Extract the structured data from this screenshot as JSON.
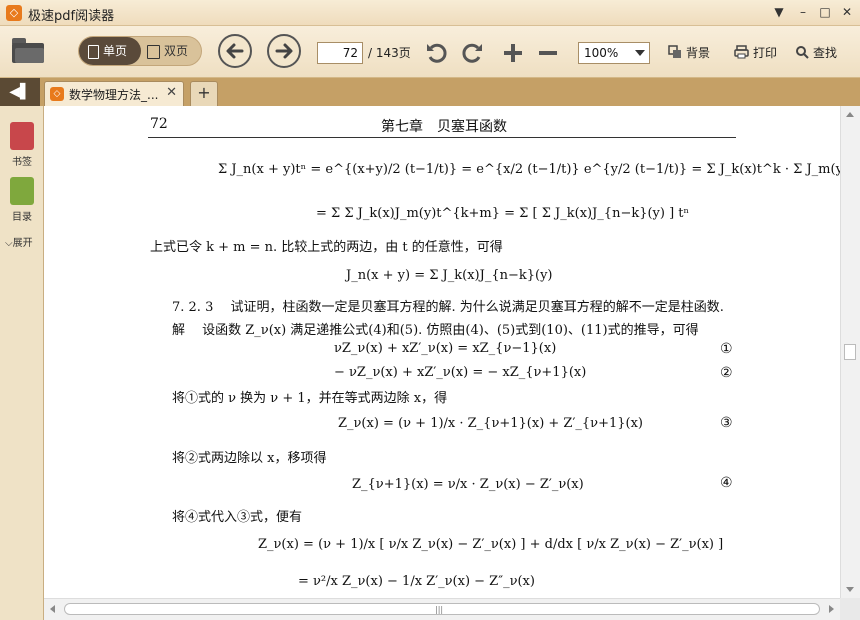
{
  "app": {
    "title": "极速pdf阅读器",
    "logo": "app-logo"
  },
  "window": {
    "menu": "▼",
    "minimize": "–",
    "maximize": "□",
    "close": "✕"
  },
  "toolbar": {
    "open_icon": "folder-icon",
    "view_single": "单页",
    "view_double": "双页",
    "page_current": "72",
    "page_total": "/ 143页",
    "zoom": "100%",
    "background": "背景",
    "print": "打印",
    "search": "查找"
  },
  "tabs": {
    "back_icon": "back-icon",
    "doc_title": "数学物理方法_...",
    "close": "✕",
    "new": "+"
  },
  "sidebar": {
    "bookmark": "书签",
    "toc": "目录",
    "expand": "展开"
  },
  "page": {
    "number": "72",
    "chapter": "第七章　贝塞耳函数",
    "lines": [
      "Σ J_n(x + y)tⁿ = e^{(x+y)/2 (t−1/t)} = e^{x/2 (t−1/t)} e^{y/2 (t−1/t)} = Σ J_k(x)t^k · Σ J_m(y)t^m",
      "= Σ Σ J_k(x)J_m(y)t^{k+m} = Σ [ Σ J_k(x)J_{n−k}(y) ] tⁿ",
      "上式已令 k + m = n. 比较上式的两边，由 t 的任意性，可得",
      "J_n(x + y) = Σ J_k(x)J_{n−k}(y)",
      "7. 2. 3　 试证明，柱函数一定是贝塞耳方程的解. 为什么说满足贝塞耳方程的解不一定是柱函数.",
      "解　 设函数 Z_ν(x) 满足递推公式(4)和(5). 仿照由(4)、(5)式到(10)、(11)式的推导，可得",
      "νZ_ν(x) + xZ′_ν(x) = xZ_{ν−1}(x)",
      "− νZ_ν(x) + xZ′_ν(x) = − xZ_{ν+1}(x)",
      "将①式的 ν 换为 ν + 1，并在等式两边除 x，得",
      "Z_ν(x) = (ν + 1)/x · Z_{ν+1}(x) + Z′_{ν+1}(x)",
      "将②式两边除以 x，移项得",
      "Z_{ν+1}(x) = ν/x · Z_ν(x) − Z′_ν(x)",
      "将④式代入③式，便有",
      "Z_ν(x) = (ν + 1)/x [ ν/x Z_ν(x) − Z′_ν(x) ] + d/dx [ ν/x Z_ν(x) − Z′_ν(x) ]",
      "= ν²/x Z_ν(x) − 1/x Z′_ν(x) − Z″_ν(x)"
    ],
    "markers": [
      "①",
      "②",
      "③",
      "④"
    ]
  }
}
